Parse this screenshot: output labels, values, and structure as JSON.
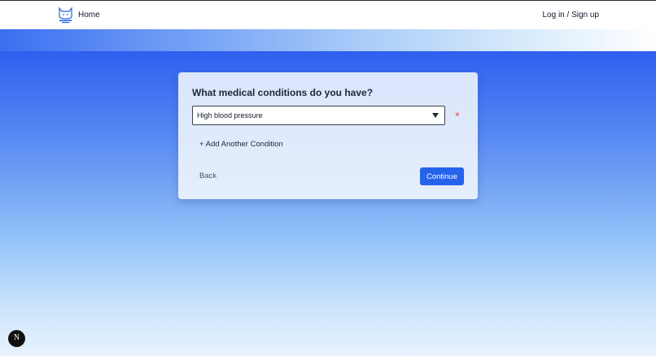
{
  "nav": {
    "logo_icon": "cat-logo-icon",
    "home_label": "Home",
    "auth_label": "Log in / Sign up"
  },
  "form": {
    "question": "What medical conditions do you have?",
    "condition_value": "High blood pressure",
    "remove_symbol": "×",
    "add_label": "+ Add Another Condition",
    "back_label": "Back",
    "continue_label": "Continue"
  },
  "badge": {
    "letter": "N"
  },
  "colors": {
    "primary": "#2563eb",
    "remove": "#dc2626",
    "bg_top": "#2f5fef",
    "bg_bottom": "#e8f3fe"
  }
}
